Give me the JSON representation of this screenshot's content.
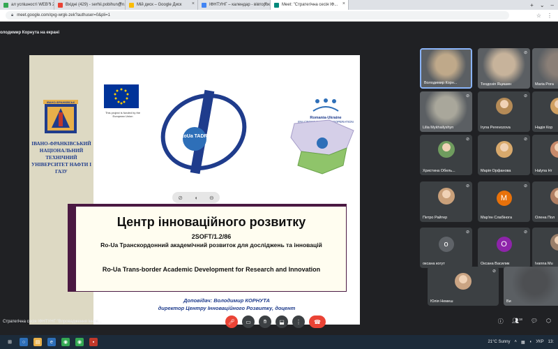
{
  "browser": {
    "tabs": [
      {
        "title": "ал успішності WEB з 2...",
        "color": "#34a853",
        "active": false
      },
      {
        "title": "Вхідні (429) - serhii.pobihun@n...",
        "color": "#ea4335",
        "active": false
      },
      {
        "title": "Мій диск – Google Диск",
        "color": "#fbbc04",
        "active": false
      },
      {
        "title": "ІФНТУНГ – календар - вівторок,...",
        "color": "#4285f4",
        "active": false
      },
      {
        "title": "Meet: \"Стратегічна сесія ІФ...",
        "color": "#00897b",
        "active": true
      }
    ],
    "new_tab_label": "+",
    "url": "meet.google.com/qxg-wrgk-zek?authuser=0&pli=1"
  },
  "meet": {
    "presenter_label": "олодимир Корнута на екрані",
    "meeting_title": "Стратегічна сесія ІФНТУНГ \"Впровадження іннов...",
    "participants_count": "18",
    "participants": [
      {
        "name": "Володимир Корн...",
        "kind": "video",
        "color": "#bfa98a",
        "muted": false,
        "active": true
      },
      {
        "name": "Теодозія Яцишин",
        "kind": "video",
        "color": "#c7b39b",
        "muted": true,
        "active": false
      },
      {
        "name": "Maria Pora",
        "kind": "video",
        "color": "#8a7f77",
        "muted": false,
        "active": false
      },
      {
        "name": "Lilia Mykhailyshyn",
        "kind": "video",
        "color": "#a9a79b",
        "muted": true,
        "active": false
      },
      {
        "name": "Iryna Perevozova",
        "kind": "photo",
        "color": "#b58b57",
        "muted": true,
        "active": false
      },
      {
        "name": "Надія Кор",
        "kind": "photo",
        "color": "#d0a062",
        "muted": false,
        "active": false
      },
      {
        "name": "Христина Обель...",
        "kind": "photo",
        "color": "#6f9c5e",
        "muted": true,
        "active": false
      },
      {
        "name": "Марія Орфанова",
        "kind": "photo",
        "color": "#d8a96c",
        "muted": true,
        "active": false
      },
      {
        "name": "Halyna Hr",
        "kind": "photo",
        "color": "#c78a6b",
        "muted": false,
        "active": false
      },
      {
        "name": "Петро Райтер",
        "kind": "photo",
        "color": "#c9a07a",
        "muted": true,
        "active": false
      },
      {
        "name": "Мар'ян Слабінога",
        "kind": "letter",
        "letter": "M",
        "color": "#e8710a",
        "muted": true,
        "active": false
      },
      {
        "name": "Олена Пол",
        "kind": "photo",
        "color": "#b07f63",
        "muted": false,
        "active": false
      },
      {
        "name": "оксана когут",
        "kind": "letter",
        "letter": "о",
        "color": "#5f6368",
        "muted": true,
        "active": false
      },
      {
        "name": "Оксана Василик",
        "kind": "letter",
        "letter": "О",
        "color": "#8e24aa",
        "muted": true,
        "active": false
      },
      {
        "name": "Ivanna Mu",
        "kind": "photo",
        "color": "#9a7f6a",
        "muted": false,
        "active": false
      },
      {
        "name": "Юлія Немеш",
        "kind": "photo",
        "color": "#caa483",
        "muted": true,
        "active": false
      },
      {
        "name": "Ви",
        "kind": "video",
        "color": "#4d4f52",
        "muted": false,
        "active": false
      }
    ]
  },
  "slide": {
    "university": "ІВАНО-ФРАНКІВСЬКИЙ НАЦІОНАЛЬНИЙ ТЕХНІЧНИЙ УНІВЕРСИТЕТ НАФТИ І ГАЗУ",
    "logo_text": "ІВАНО-ФРАНКІВСЬК",
    "eu_note": "This project is funded by the European Union",
    "roua_logo": "RoUa TADRI",
    "program_title": "Romania-Ukraine",
    "program_sub": "ENI CROSS BORDER COOPERATION",
    "main_title": "Центр інноваційного розвитку",
    "code": "2SOFT/1.2/86",
    "ua_title": "Ro-Ua Транскордонний академічний розвиток для досліджень та інновацій",
    "en_title": "Ro-Ua Trans-border Academic Development for Research and Innovation",
    "speaker_line1": "Доповідач: Володимир КОРНУТА",
    "speaker_line2": "директор Центру Інноваційного Розвитку, доцент"
  },
  "taskbar": {
    "weather": "21°C Sunny",
    "lang": "УКР",
    "time": "13:"
  },
  "colors": {
    "slide_accent": "#4a1942",
    "university_blue": "#1f3c8c",
    "meet_bg": "#202124",
    "end_call": "#ea4335"
  }
}
